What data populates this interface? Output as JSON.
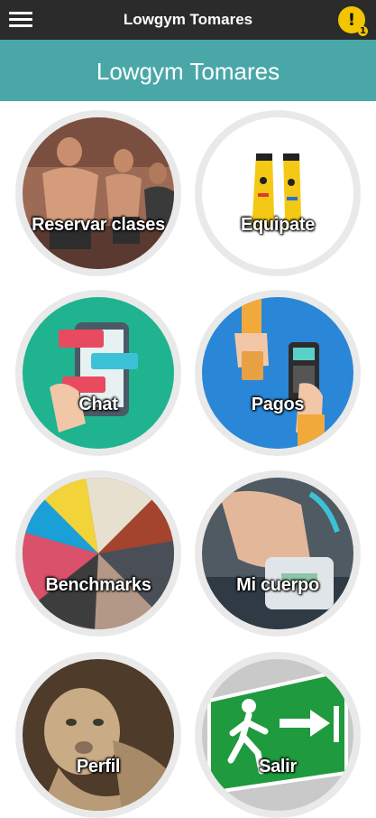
{
  "topbar": {
    "title": "Lowgym Tomares",
    "menu_icon": "hamburger-icon",
    "alert_icon": "warning-icon",
    "alert_count": "1",
    "alert_color": "#f2c500"
  },
  "header": {
    "title": "Lowgym Tomares",
    "color": "#4aa7a8"
  },
  "tiles": [
    {
      "label": "Reservar clases",
      "icon": "class-booking-photo"
    },
    {
      "label": "Equipate",
      "icon": "socks-icon"
    },
    {
      "label": "Chat",
      "icon": "chat-icon"
    },
    {
      "label": "Pagos",
      "icon": "payment-icon"
    },
    {
      "label": "Benchmarks",
      "icon": "benchmarks-collage"
    },
    {
      "label": "Mi cuerpo",
      "icon": "scale-icon"
    },
    {
      "label": "Perfil",
      "icon": "cougar-icon"
    },
    {
      "label": "Salir",
      "icon": "exit-sign-icon"
    }
  ]
}
